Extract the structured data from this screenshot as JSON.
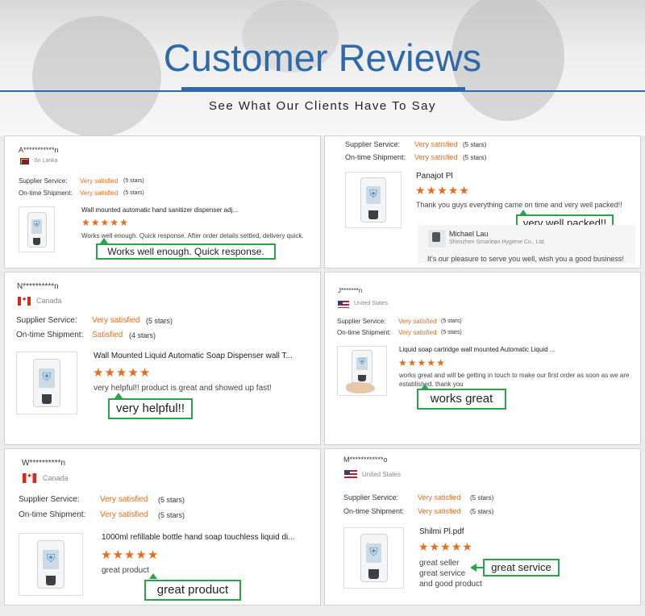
{
  "header": {
    "title": "Customer Reviews",
    "subtitle": "See What Our Clients Have To Say"
  },
  "labels": {
    "supplier_service": "Supplier Service:",
    "ontime_shipment": "On-time Shipment:"
  },
  "reviews": [
    {
      "reviewer": "A***********n",
      "country": "Sri Lanka",
      "supplier_value": "Very satisfied",
      "supplier_stars": "(5 stars)",
      "shipment_value": "Very satisfied",
      "shipment_stars": "(5 stars)",
      "product_title": "Wall mounted automatic hand sanitizer dispenser adj...",
      "rating_stars": 5,
      "comment": "Works well enough. Quick response. After order details settled, delivery quick.",
      "highlight": "Works well enough. Quick response."
    },
    {
      "supplier_value": "Very satisfied",
      "supplier_stars": "(5 stars)",
      "shipment_value": "Very satisfied",
      "shipment_stars": "(5 stars)",
      "product_title": "Panajot Pl",
      "rating_stars": 5,
      "comment": "Thank you  guys everything came on time and very well packed!!",
      "highlight": "very well packed!!",
      "reply": {
        "name": "Michael Lau",
        "company": "Shenzhen Smarlean Hygiene Co., Ltd.",
        "text": "It's our pleasure to serve you well, wish you a good business!"
      }
    },
    {
      "reviewer": "N**********n",
      "country": "Canada",
      "supplier_value": "Very satisfied",
      "supplier_stars": "(5 stars)",
      "shipment_value": "Satisfied",
      "shipment_stars": "(4 stars)",
      "product_title": "Wall Mounted Liquid Automatic Soap Dispenser wall T...",
      "rating_stars": 5,
      "comment": "very helpful!! product is great and showed up fast!",
      "highlight": "very helpful!!"
    },
    {
      "reviewer": "J*******n",
      "country": "United States",
      "supplier_value": "Very satisfied",
      "supplier_stars": "(5 stars)",
      "shipment_value": "Very satisfied",
      "shipment_stars": "(5 stars)",
      "product_title": "Liquid soap cartridge wall mounted Automatic Liquid ...",
      "rating_stars": 5,
      "comment": "works great and will be getting in touch to make our first order as soon as we are established. thank you",
      "highlight": "works great"
    },
    {
      "reviewer": "W**********n",
      "country": "Canada",
      "supplier_value": "Very satisfied",
      "supplier_stars": "(5 stars)",
      "shipment_value": "Very satisfied",
      "shipment_stars": "(5 stars)",
      "product_title": "1000ml refillable bottle hand soap touchless liquid di...",
      "rating_stars": 5,
      "comment": "great product",
      "highlight": "great product"
    },
    {
      "reviewer": "M************o",
      "country": "United States",
      "supplier_value": "Very satisfied",
      "supplier_stars": "(5 stars)",
      "shipment_value": "Very satisfied",
      "shipment_stars": "(5 stars)",
      "product_title": "Shilmi Pl.pdf",
      "rating_stars": 5,
      "comment_lines": [
        "great seller",
        "great service",
        "and good product"
      ],
      "highlight": "great service"
    }
  ],
  "icons": {
    "star": "★",
    "shield": "⛨"
  },
  "colors": {
    "title_blue": "#2e6aa8",
    "satisfied_orange": "#e86c1a",
    "callout_green": "#2aa44a"
  }
}
